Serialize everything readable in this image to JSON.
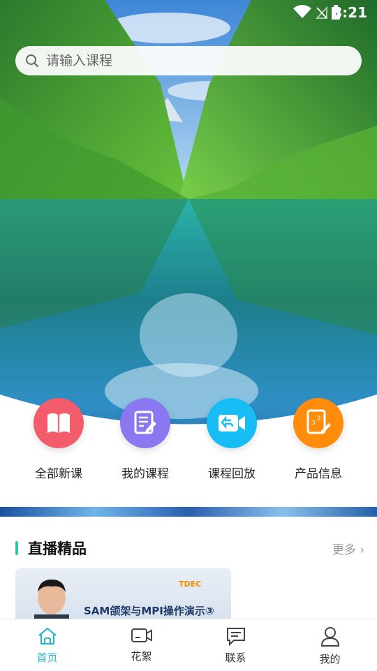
{
  "status_bar": {
    "time": "8:21"
  },
  "search": {
    "placeholder": "请输入课程"
  },
  "quick_menu": {
    "items": [
      {
        "label": "全部新课",
        "color": "#f25c6b",
        "icon": "book-icon"
      },
      {
        "label": "我的课程",
        "color": "#8b78f0",
        "icon": "edit-note-icon"
      },
      {
        "label": "课程回放",
        "color": "#19bdf5",
        "icon": "replay-video-icon"
      },
      {
        "label": "产品信息",
        "color": "#ff8c0a",
        "icon": "product-doc-icon"
      }
    ]
  },
  "live_section": {
    "title": "直播精品",
    "more": "更多 ›",
    "accent_color": "#2ec4a6",
    "card": {
      "brand": "TDEC",
      "title": "SAM颌架与MPI操作演示③"
    }
  },
  "tab_bar": {
    "active_color": "#25b9c4",
    "items": [
      {
        "label": "首页",
        "icon": "home-icon",
        "active": true
      },
      {
        "label": "花絮",
        "icon": "video-icon",
        "active": false
      },
      {
        "label": "联系",
        "icon": "message-icon",
        "active": false
      },
      {
        "label": "我的",
        "icon": "user-icon",
        "active": false
      }
    ]
  }
}
